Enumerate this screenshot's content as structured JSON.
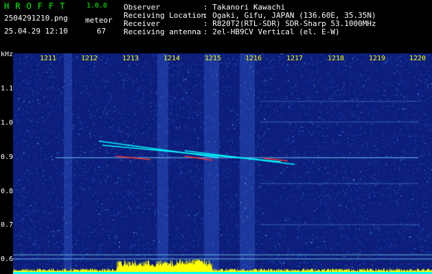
{
  "header": {
    "brand": "HROFFT",
    "version": "1.0.0",
    "filename": "2504291210.png",
    "datetime": "25.04.29 12:10",
    "mode": "meteor",
    "count": "67"
  },
  "info": [
    {
      "label": "Observer",
      "value": ": Takanori Kawachi"
    },
    {
      "label": "Receiving Location",
      "value": ": Ogaki, Gifu, JAPAN (136.60E, 35.35N)"
    },
    {
      "label": "Receiver",
      "value": ": R820T2(RTL-SDR) SDR-Sharp 53.1000MHz"
    },
    {
      "label": "Receiving antenna",
      "value": ": 2el-HB9CV Vertical (el. E-W)"
    }
  ],
  "axis": {
    "y_unit": "kHz",
    "y_ticks": [
      "1.1",
      "1.0",
      "0.9",
      "0.8",
      "0.7",
      "0.6"
    ],
    "x_ticks": [
      "1211",
      "1212",
      "1213",
      "1214",
      "1215",
      "1216",
      "1217",
      "1218",
      "1219",
      "1220"
    ]
  },
  "colors": {
    "background": "#000000",
    "plot_background": "#0c1d7a",
    "label_green": "#00ff00",
    "tick_yellow": "#ffff00",
    "signal_cyan": "#00ffff",
    "signal_red": "#ff3030",
    "power_yellow": "#ffff00"
  }
}
